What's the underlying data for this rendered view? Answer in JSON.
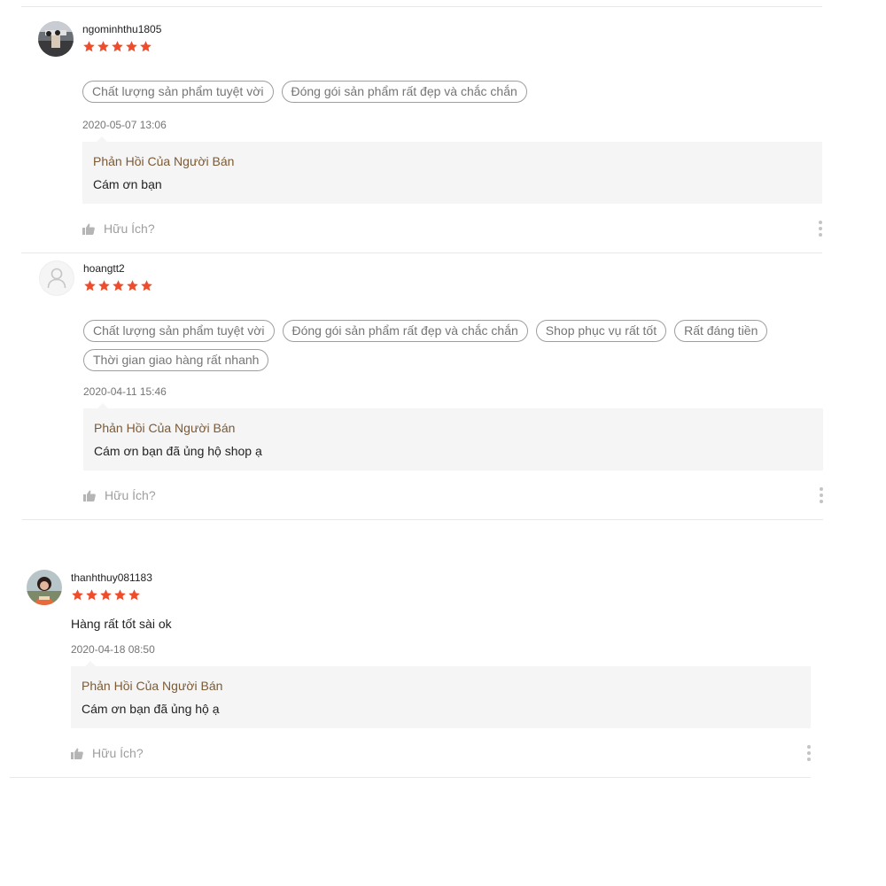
{
  "reviews": [
    {
      "username": "ngominhthu1805",
      "rating": 5,
      "tags": [
        "Chất lượng sản phẩm tuyệt vời",
        "Đóng gói sản phẩm rất đẹp và chắc chắn"
      ],
      "datetime": "2020-05-07 13:06",
      "reply_title": "Phản Hồi Của Người Bán",
      "reply_text": "Cám ơn bạn",
      "helpful_label": "Hữu Ích?"
    },
    {
      "username": "hoangtt2",
      "rating": 5,
      "tags": [
        "Chất lượng sản phẩm tuyệt vời",
        "Đóng gói sản phẩm rất đẹp và chắc chắn",
        "Shop phục vụ rất tốt",
        "Rất đáng tiền",
        "Thời gian giao hàng rất nhanh"
      ],
      "datetime": "2020-04-11 15:46",
      "reply_title": "Phản Hồi Của Người Bán",
      "reply_text": "Cám ơn bạn đã ủng hộ shop ạ",
      "helpful_label": "Hữu Ích?"
    },
    {
      "username": "thanhthuy081183",
      "rating": 5,
      "comment": "Hàng rất tốt sài ok",
      "datetime": "2020-04-18 08:50",
      "reply_title": "Phản Hồi Của Người Bán",
      "reply_text": "Cám ơn bạn đã ủng hộ ạ",
      "helpful_label": "Hữu Ích?"
    }
  ],
  "colors": {
    "star": "#ee4d2d",
    "reply_title": "#7b5a36",
    "muted": "#9e9e9e",
    "reply_bg": "#f5f5f5"
  },
  "icons": {
    "star": "star-icon",
    "like": "thumbs-up-icon",
    "more": "more-vertical-icon",
    "default_avatar": "user-icon"
  }
}
